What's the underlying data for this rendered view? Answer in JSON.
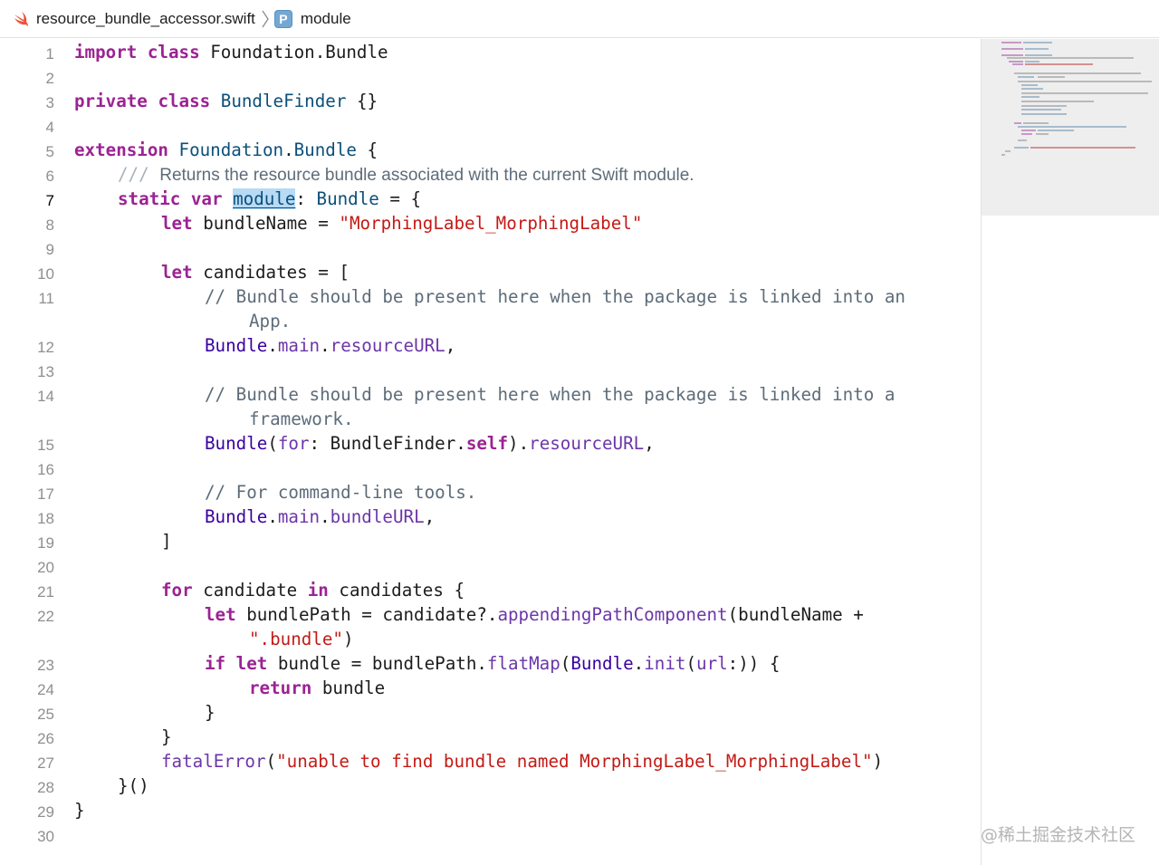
{
  "jumpbar": {
    "file_icon": "swift-icon",
    "file_name": "resource_bundle_accessor.swift",
    "separator_icon": "chevron-right-icon",
    "symbol_badge": "P",
    "symbol_name": "module"
  },
  "current_line": "7",
  "gutter": [
    "1",
    "2",
    "3",
    "4",
    "5",
    "6",
    "7",
    "8",
    "9",
    "10",
    "11",
    "",
    "12",
    "13",
    "14",
    "",
    "15",
    "16",
    "17",
    "18",
    "19",
    "20",
    "21",
    "22",
    "",
    "23",
    "24",
    "25",
    "26",
    "27",
    "28",
    "29",
    "30"
  ],
  "code": {
    "l1": {
      "kw1": "import",
      "kw2": "class",
      "rest": " Foundation.Bundle"
    },
    "l3": {
      "kw1": "private",
      "kw2": "class",
      "name": "BundleFinder",
      "rest": " {}"
    },
    "l5": {
      "kw": "extension",
      "t1": "Foundation",
      "dot": ".",
      "t2": "Bundle",
      "rest": " {"
    },
    "l6": {
      "marker": "///",
      "text": "Returns the resource bundle associated with the current Swift module."
    },
    "l7": {
      "kw1": "static",
      "kw2": "var",
      "name": "module",
      "colon": ":",
      "type": "Bundle",
      "rest": " = {"
    },
    "l8": {
      "kw": "let",
      "mid": " bundleName = ",
      "str": "\"MorphingLabel_MorphingLabel\""
    },
    "l10": {
      "kw": "let",
      "rest": " candidates = ["
    },
    "l11": {
      "comment": "// Bundle should be present here when the package is linked into an"
    },
    "l11b": {
      "comment": "App."
    },
    "l12": {
      "cls": "Bundle",
      "d1": ".",
      "m1": "main",
      "d2": ".",
      "m2": "resourceURL",
      "rest": ","
    },
    "l14": {
      "comment": "// Bundle should be present here when the package is linked into a"
    },
    "l14b": {
      "comment": "framework."
    },
    "l15": {
      "cls": "Bundle",
      "p1": "(",
      "arg": "for",
      "p2": ": BundleFinder.",
      "kw": "self",
      "p3": ").",
      "mem": "resourceURL",
      "rest": ","
    },
    "l17": {
      "comment": "// For command-line tools."
    },
    "l18": {
      "cls": "Bundle",
      "d1": ".",
      "m1": "main",
      "d2": ".",
      "m2": "bundleURL",
      "rest": ","
    },
    "l19": {
      "text": "]"
    },
    "l21": {
      "kw1": "for",
      "mid": " candidate ",
      "kw2": "in",
      "rest": " candidates {"
    },
    "l22": {
      "kw": "let",
      "mid": " bundlePath = candidate?.",
      "mem": "appendingPathComponent",
      "rest": "(bundleName +"
    },
    "l22b": {
      "str": "\".bundle\"",
      "rest": ")"
    },
    "l23": {
      "kw1": "if",
      "kw2": "let",
      "mid": " bundle = bundlePath.",
      "mem": "flatMap",
      "p1": "(",
      "cls": "Bundle",
      "d": ".",
      "init": "init",
      "p2": "(",
      "arg": "url",
      "rest": ":)) {"
    },
    "l24": {
      "kw": "return",
      "rest": " bundle"
    },
    "l25": {
      "text": "}"
    },
    "l26": {
      "text": "}"
    },
    "l27": {
      "mem": "fatalError",
      "p1": "(",
      "str": "\"unable to find bundle named MorphingLabel_MorphingLabel\"",
      "rest": ")"
    },
    "l28": {
      "text": "}()"
    },
    "l29": {
      "text": "}"
    }
  },
  "colors": {
    "keyword": "#9b2393",
    "type": "#0b4f79",
    "class": "#3900a0",
    "member": "#6c36a9",
    "string": "#c41a16",
    "comment": "#5d6c79",
    "highlight": "#b7daf5"
  },
  "watermark": "@稀土掘金技术社区"
}
